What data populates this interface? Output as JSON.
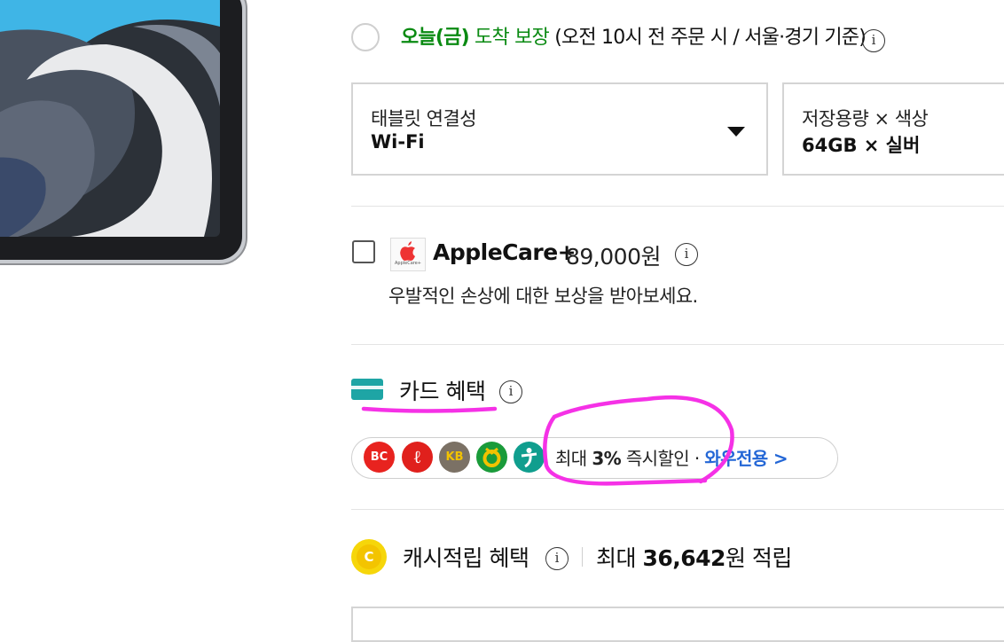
{
  "delivery": {
    "day_label": "오늘(금)",
    "guarantee_label": " 도착 보장 ",
    "condition": "(오전 10시 전 주문 시 / 서울·경기 기준)",
    "info_glyph": "i"
  },
  "options": [
    {
      "label": "태블릿 연결성",
      "value": "Wi-Fi"
    },
    {
      "label": "저장용량 × 색상",
      "value": "64GB × 실버"
    }
  ],
  "applecare": {
    "name": "AppleCare+",
    "price": "89,000원",
    "description": "우발적인 손상에 대한 보상을 받아보세요.",
    "logo_text": "AppleCare+",
    "info_glyph": "i"
  },
  "card_benefit": {
    "title": "카드 혜택",
    "info_glyph": "i",
    "banks": [
      {
        "icon": "bc-card-icon",
        "text": "BC",
        "color": "#e8231f"
      },
      {
        "icon": "lotte-card-icon",
        "text": "ℓ",
        "color": "#e0201c"
      },
      {
        "icon": "kb-card-icon",
        "text": "KB",
        "color": "#7b7165"
      },
      {
        "icon": "nh-card-icon",
        "text": "",
        "color": "#1a9b3a"
      },
      {
        "icon": "hana-card-icon",
        "text": "",
        "color": "#109e8e"
      }
    ],
    "text_prefix": "최대 ",
    "text_rate": "3%",
    "text_mid": " 즉시할인 · ",
    "text_link": "와우전용 >"
  },
  "cash": {
    "coin_text": "C",
    "label": "캐시적립 혜택",
    "info_glyph": "i",
    "amount_prefix": "최대 ",
    "amount_value": "36,642",
    "amount_suffix": "원 적립"
  },
  "colors": {
    "green": "#0a8a12",
    "link_blue": "#2467d6",
    "card_teal": "#1ea5a5",
    "annotation_magenta": "#f531e6"
  }
}
